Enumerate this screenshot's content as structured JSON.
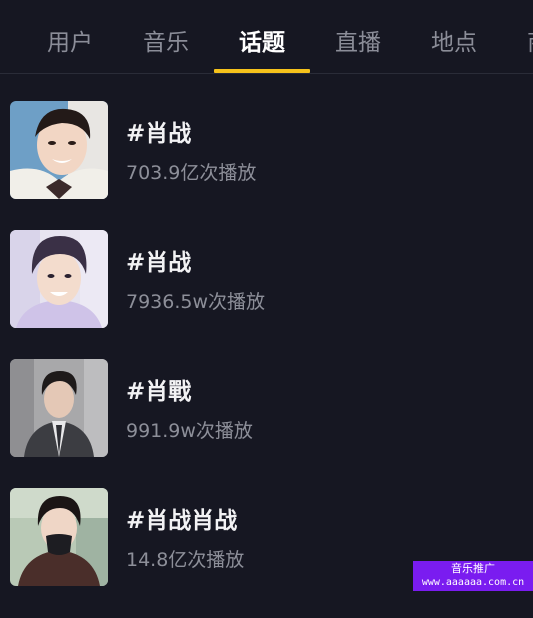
{
  "tabs": [
    {
      "label": "用户"
    },
    {
      "label": "音乐"
    },
    {
      "label": "话题"
    },
    {
      "label": "直播"
    },
    {
      "label": "地点"
    },
    {
      "label": "商"
    }
  ],
  "active_tab": "话题",
  "accent_color": "#f5c21b",
  "results": [
    {
      "title": "#肖战",
      "plays": "703.9亿次播放"
    },
    {
      "title": "#肖战",
      "plays": "7936.5w次播放"
    },
    {
      "title": "#肖戰",
      "plays": "991.9w次播放"
    },
    {
      "title": "#肖战肖战",
      "plays": "14.8亿次播放"
    }
  ],
  "watermark": {
    "line1": "音乐推广",
    "line2": "www.aaaaaa.com.cn"
  }
}
